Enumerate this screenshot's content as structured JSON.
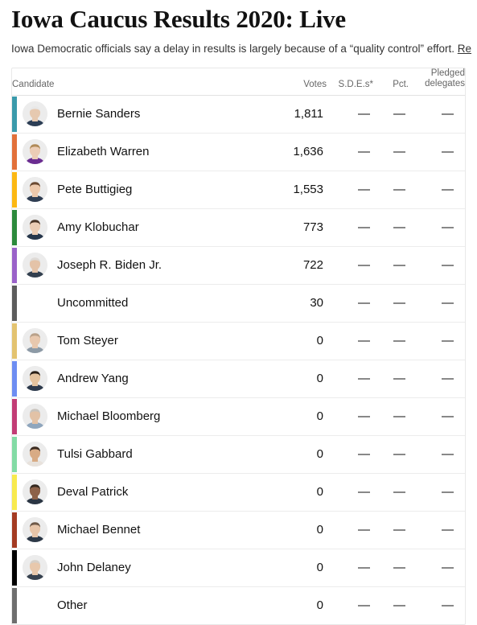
{
  "headline": "Iowa Caucus Results 2020: Live",
  "subhead": {
    "text": "Iowa Democratic officials say a delay in results is largely because of a “quality control” effort. ",
    "link_text": "Re"
  },
  "table": {
    "headers": {
      "candidate": "Candidate",
      "votes": "Votes",
      "sdes": "S.D.E.s*",
      "pct": "Pct.",
      "pledged_line1": "Pledged",
      "pledged_line2": "delegates"
    },
    "dash": "—",
    "rows": [
      {
        "name": "Bernie Sanders",
        "votes": "1,811",
        "sdes": "—",
        "pct": "—",
        "pledged": "—",
        "color": "#3a9aab",
        "has_photo": true,
        "hair": "#e8e8e8",
        "skin": "#e6c9b0",
        "suit": "#2c3e55"
      },
      {
        "name": "Elizabeth Warren",
        "votes": "1,636",
        "sdes": "—",
        "pct": "—",
        "pledged": "—",
        "color": "#e2703a",
        "has_photo": true,
        "hair": "#b08a58",
        "skin": "#eccdb6",
        "suit": "#6b2d91"
      },
      {
        "name": "Pete Buttigieg",
        "votes": "1,553",
        "sdes": "—",
        "pct": "—",
        "pledged": "—",
        "color": "#fcb813",
        "has_photo": true,
        "hair": "#6b4a32",
        "skin": "#edc9ac",
        "suit": "#2f3d52"
      },
      {
        "name": "Amy Klobuchar",
        "votes": "773",
        "sdes": "—",
        "pct": "—",
        "pledged": "—",
        "color": "#2c8a3c",
        "has_photo": true,
        "hair": "#4a3526",
        "skin": "#eccdb4",
        "suit": "#26364a"
      },
      {
        "name": "Joseph R. Biden Jr.",
        "votes": "722",
        "sdes": "—",
        "pct": "—",
        "pledged": "—",
        "color": "#9a62c9",
        "has_photo": true,
        "hair": "#dedad6",
        "skin": "#e4c3a8",
        "suit": "#33404f"
      },
      {
        "name": "Uncommitted",
        "votes": "30",
        "sdes": "—",
        "pct": "—",
        "pledged": "—",
        "color": "#5c5c5c",
        "has_photo": false,
        "hair": "",
        "skin": "",
        "suit": ""
      },
      {
        "name": "Tom Steyer",
        "votes": "0",
        "sdes": "—",
        "pct": "—",
        "pledged": "—",
        "color": "#e3c370",
        "has_photo": true,
        "hair": "#b9a18a",
        "skin": "#e8c8ae",
        "suit": "#8d9aa6"
      },
      {
        "name": "Andrew Yang",
        "votes": "0",
        "sdes": "—",
        "pct": "—",
        "pledged": "—",
        "color": "#6d8df2",
        "has_photo": true,
        "hair": "#2b2118",
        "skin": "#e4c39f",
        "suit": "#2d3a4c"
      },
      {
        "name": "Michael Bloomberg",
        "votes": "0",
        "sdes": "—",
        "pct": "—",
        "pledged": "—",
        "color": "#c23c75",
        "has_photo": true,
        "hair": "#c9c4bd",
        "skin": "#e2c2a6",
        "suit": "#8fa6bd"
      },
      {
        "name": "Tulsi Gabbard",
        "votes": "0",
        "sdes": "—",
        "pct": "—",
        "pledged": "—",
        "color": "#83dba5",
        "has_photo": true,
        "hair": "#3a2a20",
        "skin": "#d8ab85",
        "suit": "#e8e2dc"
      },
      {
        "name": "Deval Patrick",
        "votes": "0",
        "sdes": "—",
        "pct": "—",
        "pledged": "—",
        "color": "#f8ea4e",
        "has_photo": true,
        "hair": "#33281f",
        "skin": "#8d6249",
        "suit": "#2b3644"
      },
      {
        "name": "Michael Bennet",
        "votes": "0",
        "sdes": "—",
        "pct": "—",
        "pledged": "—",
        "color": "#a43b22",
        "has_photo": true,
        "hair": "#6e5948",
        "skin": "#e7c5a9",
        "suit": "#2c3847"
      },
      {
        "name": "John Delaney",
        "votes": "0",
        "sdes": "—",
        "pct": "—",
        "pledged": "—",
        "color": "#000000",
        "has_photo": true,
        "hair": "#d6d0c8",
        "skin": "#e8c8ac",
        "suit": "#37424f"
      },
      {
        "name": "Other",
        "votes": "0",
        "sdes": "—",
        "pct": "—",
        "pledged": "—",
        "color": "#6e6e6e",
        "has_photo": false,
        "hair": "",
        "skin": "",
        "suit": ""
      }
    ]
  }
}
